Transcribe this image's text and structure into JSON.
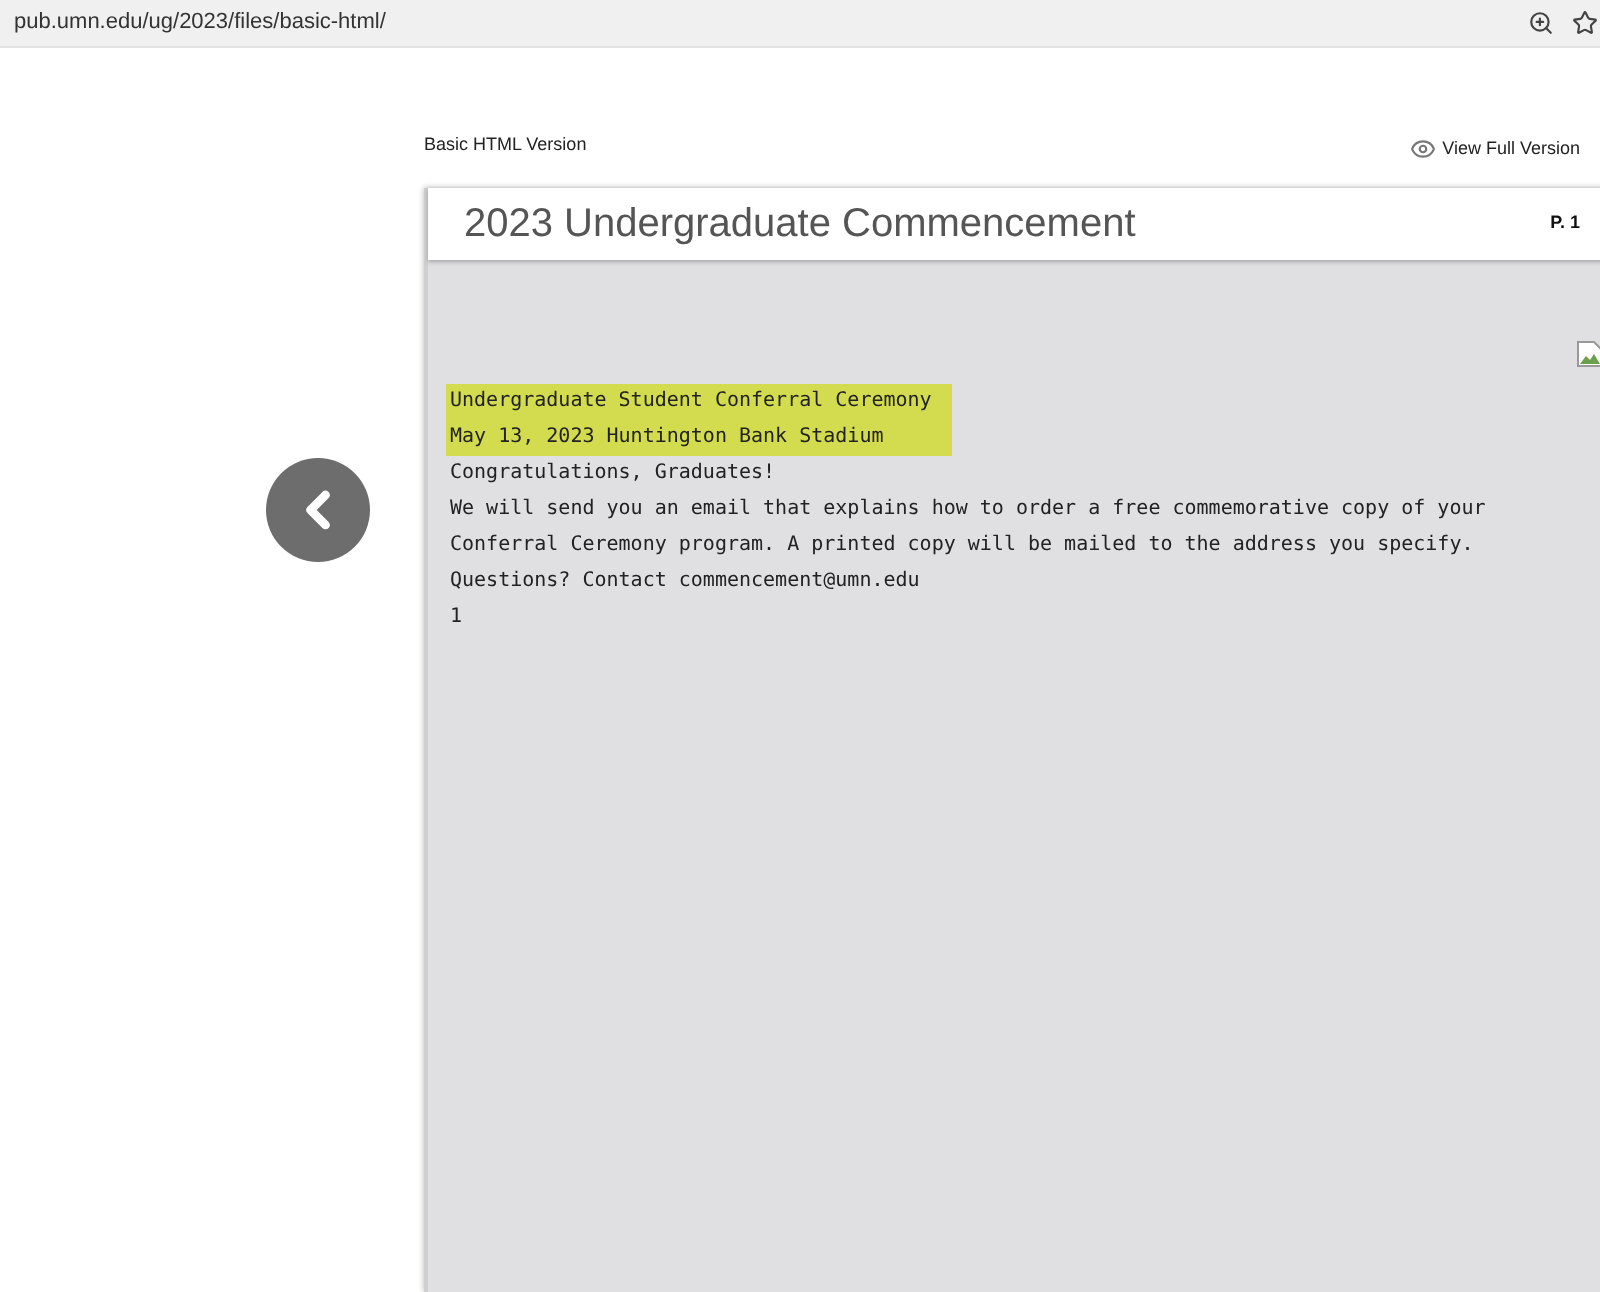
{
  "address_bar": {
    "url": "pub.umn.edu/ug/2023/files/basic-html/"
  },
  "page": {
    "version_label": "Basic HTML Version",
    "full_version_link": "View Full Version"
  },
  "document": {
    "title": "2023 Undergraduate Commencement",
    "page_number": "P. 1",
    "lines": [
      {
        "text": "Undergraduate Student Conferral Ceremony",
        "highlighted": true
      },
      {
        "text": "May 13, 2023 Huntington Bank Stadium",
        "highlighted": true
      },
      {
        "text": "Congratulations, Graduates!",
        "highlighted": false
      },
      {
        "text": "We will send you an email that explains how to order a free commemorative copy of your Conferral Ceremony program. A printed copy will be mailed to the address you specify. Questions? Contact commencement@umn.edu",
        "highlighted": false
      },
      {
        "text": "1",
        "highlighted": false
      }
    ]
  }
}
